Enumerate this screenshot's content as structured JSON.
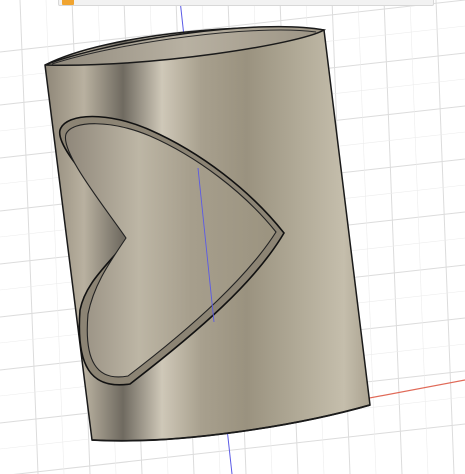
{
  "viewport": {
    "name": "3d-viewport",
    "background": "#ffffff",
    "grid_color": "#d9d9d9",
    "x_axis_color": "#e05a4a",
    "z_axis_color": "#4a4ae0"
  },
  "toolbar": {
    "icon": "orange-app-icon",
    "partial_text": ""
  },
  "model": {
    "shape": "cylinder-with-heart-cutout",
    "body_color": "#a59c8a",
    "edge_color": "#1a1a1a"
  }
}
